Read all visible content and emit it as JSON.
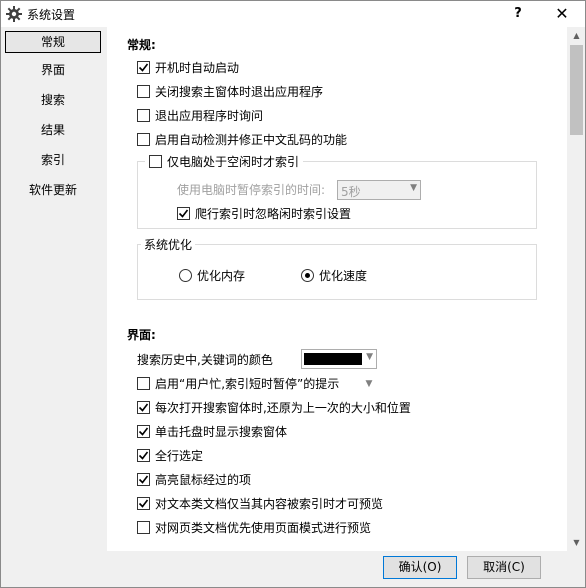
{
  "window": {
    "title": "系统设置",
    "help_label": "?",
    "close_label": "✕"
  },
  "nav": {
    "items": [
      {
        "label": "常规",
        "active": true
      },
      {
        "label": "界面",
        "active": false
      },
      {
        "label": "搜索",
        "active": false
      },
      {
        "label": "结果",
        "active": false
      },
      {
        "label": "索引",
        "active": false
      },
      {
        "label": "软件更新",
        "active": false
      }
    ]
  },
  "general": {
    "title": "常规:",
    "options": [
      {
        "label": "开机时自动启动",
        "checked": true
      },
      {
        "label": "关闭搜索主窗体时退出应用程序",
        "checked": false
      },
      {
        "label": "退出应用程序时询问",
        "checked": false
      },
      {
        "label": "启用自动检测并修正中文乱码的功能",
        "checked": false
      }
    ],
    "idle_index": {
      "label": "仅电脑处于空闲时才索引",
      "checked": false,
      "pause_label": "使用电脑时暂停索引的时间:",
      "pause_value": "5秒",
      "ignore_label": "爬行索引时忽略闲时索引设置",
      "ignore_checked": true
    },
    "optimize": {
      "legend": "系统优化",
      "options": [
        {
          "label": "优化内存",
          "selected": false
        },
        {
          "label": "优化速度",
          "selected": true
        }
      ]
    }
  },
  "interface": {
    "title": "界面:",
    "keyword_color_label": "搜索历史中,关键词的颜色",
    "keyword_color": "#000000",
    "options": [
      {
        "label": "启用“用户忙,索引短时暂停”的提示",
        "checked": false,
        "dropdown": true
      },
      {
        "label": "每次打开搜索窗体时,还原为上一次的大小和位置",
        "checked": true
      },
      {
        "label": "单击托盘时显示搜索窗体",
        "checked": true
      },
      {
        "label": "全行选定",
        "checked": true
      },
      {
        "label": "高亮鼠标经过的项",
        "checked": true
      },
      {
        "label": "对文本类文档仅当其内容被索引时才可预览",
        "checked": true
      },
      {
        "label": "对网页类文档优先使用页面模式进行预览",
        "checked": false
      }
    ]
  },
  "buttons": {
    "ok": "确认(O)",
    "cancel": "取消(C)"
  }
}
